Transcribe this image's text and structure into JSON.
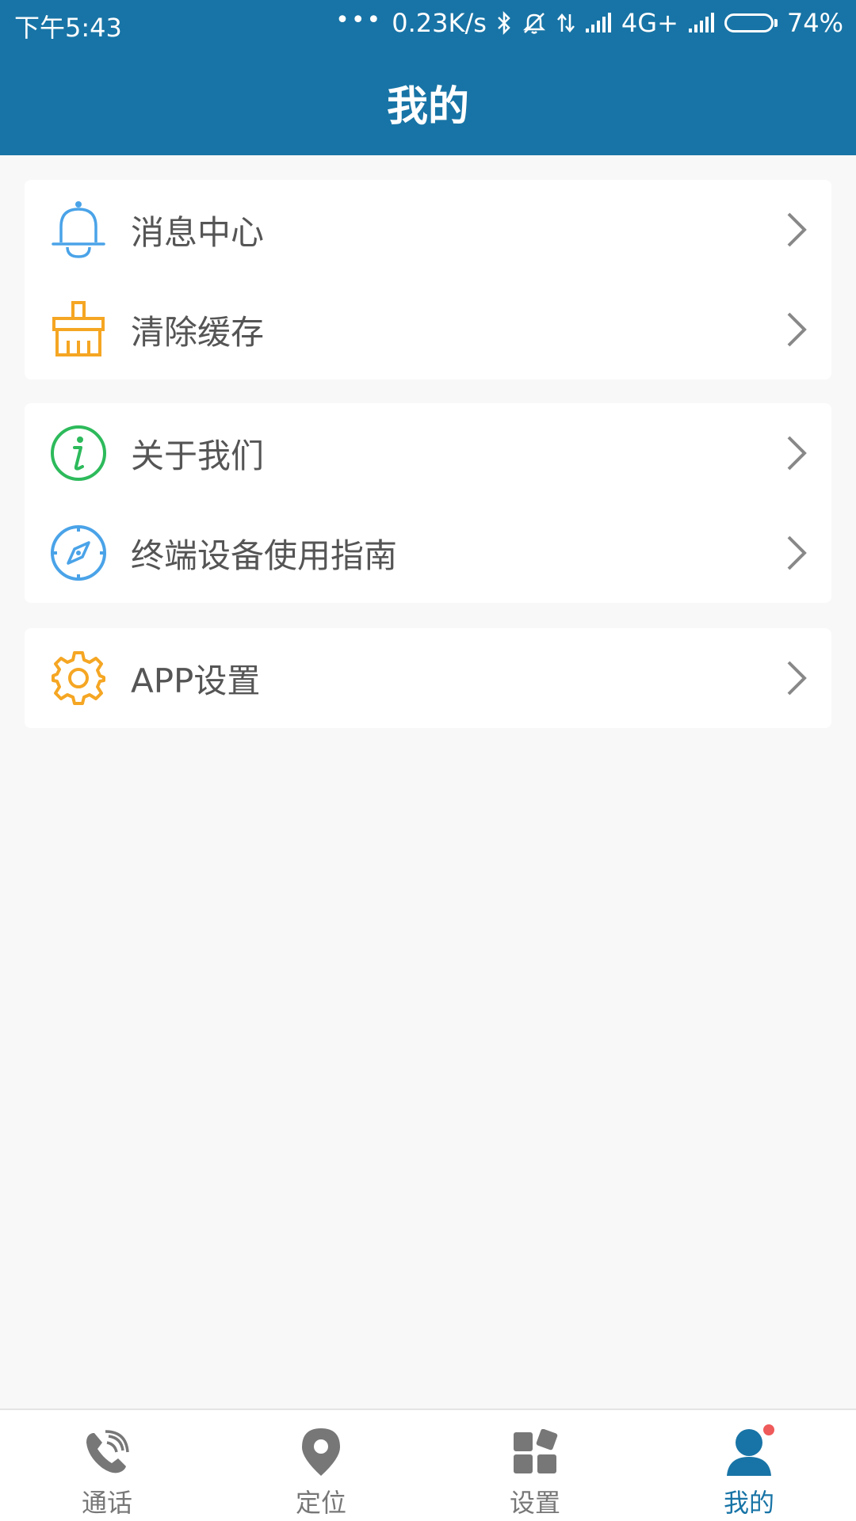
{
  "status_bar": {
    "time": "下午5:43",
    "dots": "•••",
    "net_speed": "0.23K/s",
    "network": "4G+",
    "battery": "74%",
    "battery_level": 0.74,
    "icons": [
      "bluetooth-icon",
      "mute-icon",
      "data-arrows-icon",
      "signal-icon",
      "signal-icon"
    ]
  },
  "header": {
    "title": "我的"
  },
  "menu": {
    "groups": [
      {
        "items": [
          {
            "label": "消息中心",
            "icon": "bell-icon",
            "color": "#4aa3e8"
          },
          {
            "label": "清除缓存",
            "icon": "broom-icon",
            "color": "#f5a623"
          }
        ]
      },
      {
        "items": [
          {
            "label": "关于我们",
            "icon": "info-icon",
            "color": "#2dba5b"
          },
          {
            "label": "终端设备使用指南",
            "icon": "compass-icon",
            "color": "#4aa3e8"
          }
        ]
      },
      {
        "items": [
          {
            "label": "APP设置",
            "icon": "gear-icon",
            "color": "#f5a623"
          }
        ]
      }
    ]
  },
  "bottom_nav": {
    "items": [
      {
        "label": "通话",
        "icon": "phone-icon",
        "active": false
      },
      {
        "label": "定位",
        "icon": "location-pin-icon",
        "active": false
      },
      {
        "label": "设置",
        "icon": "grid-icon",
        "active": false
      },
      {
        "label": "我的",
        "icon": "user-icon",
        "active": true,
        "badge": true
      }
    ]
  },
  "colors": {
    "primary": "#1874a6",
    "background": "#f8f8f8",
    "nav_inactive": "#777777",
    "badge": "#ef5a5a",
    "chevron": "#888888"
  }
}
